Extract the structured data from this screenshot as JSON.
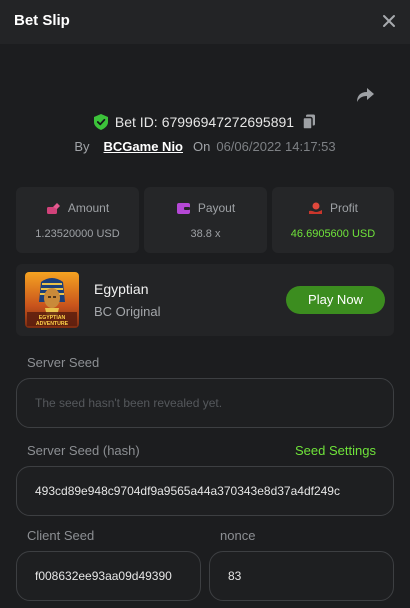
{
  "header": {
    "title": "Bet Slip"
  },
  "bet": {
    "id_label": "Bet ID:",
    "id_value": "67996947272695891",
    "by_label": "By",
    "user": "BCGame Nio",
    "on_label": "On",
    "date": "06/06/2022 14:17:53"
  },
  "stats": [
    {
      "label": "Amount",
      "value": "1.23520000 USD",
      "icon": "amount-icon"
    },
    {
      "label": "Payout",
      "value": "38.8 x",
      "icon": "wallet-icon"
    },
    {
      "label": "Profit",
      "value": "46.6905600 USD",
      "icon": "profit-icon"
    }
  ],
  "game": {
    "name": "Egyptian",
    "provider": "BC Original",
    "play_label": "Play Now",
    "thumb_text": "EGYPTIAN ADVENTURE"
  },
  "fields": {
    "server_seed_label": "Server Seed",
    "server_seed_placeholder": "The seed hasn't been revealed yet.",
    "server_hash_label": "Server Seed (hash)",
    "seed_settings": "Seed Settings",
    "server_hash_value": "493cd89e948c9704df9a9565a44a370343e8d37a4df249c",
    "client_seed_label": "Client Seed",
    "client_seed_value": "f008632ee93aa09d49390",
    "nonce_label": "nonce",
    "nonce_value": "83"
  },
  "colors": {
    "accent": "#6fe33a",
    "play_button": "#3c8d1f",
    "panel": "#252628"
  }
}
